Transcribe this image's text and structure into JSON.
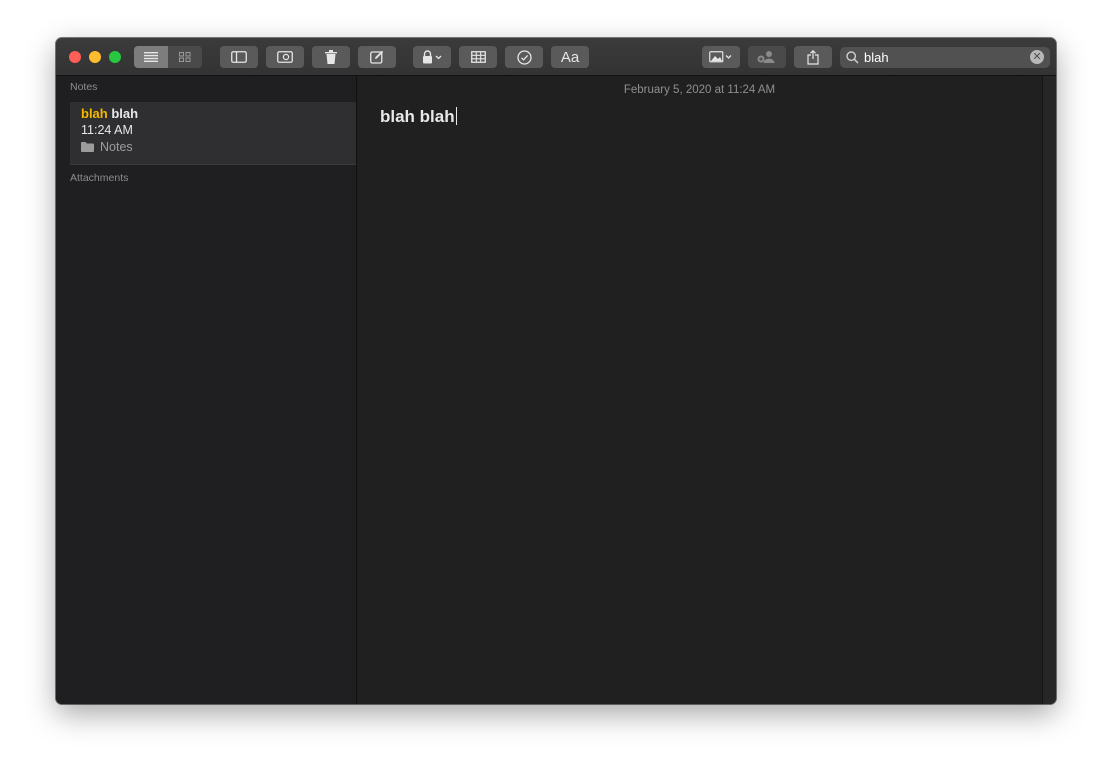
{
  "toolbar": {
    "list_view_icon": "list-view-icon",
    "gallery_view_icon": "gallery-view-icon",
    "sidebar_toggle_icon": "sidebar-icon",
    "attachments_icon": "attachments-icon",
    "delete_icon": "trash-icon",
    "compose_icon": "compose-icon",
    "lock_icon": "lock-icon",
    "table_icon": "table-icon",
    "checklist_icon": "checklist-icon",
    "format_label": "Aa",
    "media_icon": "photo-icon",
    "collaborate_icon": "add-people-icon",
    "share_icon": "share-icon"
  },
  "search": {
    "value": "blah",
    "clear_icon": "clear-icon"
  },
  "sidebar": {
    "notes_header": "Notes",
    "attachments_header": "Attachments",
    "note": {
      "title_highlight": "blah",
      "title_rest": " blah",
      "time": "11:24 AM",
      "folder": "Notes"
    }
  },
  "editor": {
    "date": "February 5, 2020 at 11:24 AM",
    "text": "blah blah"
  },
  "colors": {
    "highlight": "#f5b800",
    "window_bg": "#1e1e1e"
  }
}
